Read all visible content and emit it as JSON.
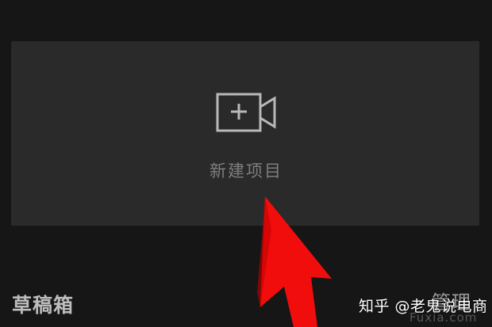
{
  "new_project": {
    "icon": "video-camera-plus-icon",
    "label": "新建项目"
  },
  "drafts": {
    "title": "草稿箱",
    "manage_label": "管理"
  },
  "watermark": {
    "text": "知乎 @老鬼说电商",
    "faint_text": "Fuxia.com"
  },
  "annotation": {
    "icon": "red-arrow-icon",
    "color": "#f20d0d"
  },
  "colors": {
    "background": "#161616",
    "card": "#2a2a2a",
    "icon_stroke": "#b9b9b9",
    "label": "#7e7e7e"
  }
}
